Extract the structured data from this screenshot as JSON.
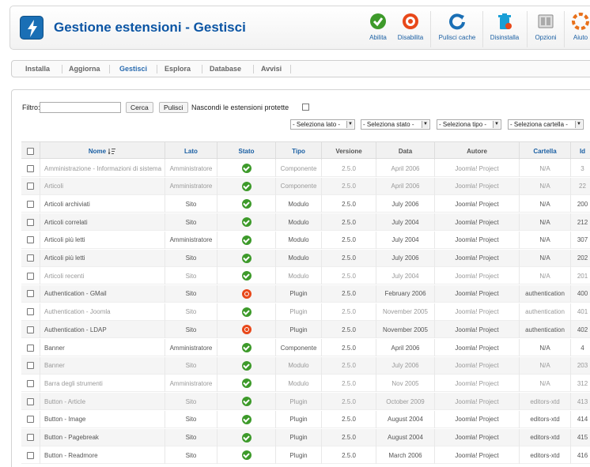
{
  "header": {
    "title": "Gestione estensioni - Gestisci",
    "toolbar": [
      {
        "label": "Abilita",
        "icon": "enable-icon",
        "color": "#3d9a2a"
      },
      {
        "label": "Disabilita",
        "icon": "disable-icon",
        "color": "#e8481a"
      },
      {
        "label": "Pulisci cache",
        "icon": "refresh-icon",
        "color": "#1a6fb5"
      },
      {
        "label": "Disinstalla",
        "icon": "trash-icon",
        "color": "#1a9fd6"
      },
      {
        "label": "Opzioni",
        "icon": "options-icon",
        "color": "#888888"
      },
      {
        "label": "Aiuto",
        "icon": "help-icon",
        "color": "#e8701a"
      }
    ]
  },
  "submenu": {
    "tabs": [
      "Installa",
      "Aggiorna",
      "Gestisci",
      "Esplora",
      "Database",
      "Avvisi"
    ],
    "active": "Gestisci"
  },
  "filter": {
    "label": "Filtro:",
    "value": "",
    "search_label": "Cerca",
    "clear_label": "Pulisci",
    "hide_protected_label": "Nascondi le estensioni protette",
    "hide_protected_checked": false
  },
  "selects": [
    {
      "value": "- Seleziona lato -"
    },
    {
      "value": "- Seleziona stato -"
    },
    {
      "value": "- Seleziona tipo -"
    },
    {
      "value": "- Seleziona cartella -"
    }
  ],
  "table": {
    "columns": [
      "Nome",
      "Lato",
      "Stato",
      "Tipo",
      "Versione",
      "Data",
      "Autore",
      "Cartella",
      "Id"
    ],
    "sorted_by": "Nome",
    "rows": [
      {
        "name": "Amministrazione - Informazioni di sistema",
        "side": "Amministratore",
        "status": "enabled",
        "type": "Componente",
        "version": "2.5.0",
        "date": "April 2006",
        "author": "Joomla! Project",
        "folder": "N/A",
        "id": "3",
        "dim": true
      },
      {
        "name": "Articoli",
        "side": "Amministratore",
        "status": "enabled",
        "type": "Componente",
        "version": "2.5.0",
        "date": "April 2006",
        "author": "Joomla! Project",
        "folder": "N/A",
        "id": "22",
        "dim": true
      },
      {
        "name": "Articoli archiviati",
        "side": "Sito",
        "status": "enabled",
        "type": "Modulo",
        "version": "2.5.0",
        "date": "July 2006",
        "author": "Joomla! Project",
        "folder": "N/A",
        "id": "200",
        "dim": false
      },
      {
        "name": "Articoli correlati",
        "side": "Sito",
        "status": "enabled",
        "type": "Modulo",
        "version": "2.5.0",
        "date": "July 2004",
        "author": "Joomla! Project",
        "folder": "N/A",
        "id": "212",
        "dim": false
      },
      {
        "name": "Articoli più letti",
        "side": "Amministratore",
        "status": "enabled",
        "type": "Modulo",
        "version": "2.5.0",
        "date": "July 2004",
        "author": "Joomla! Project",
        "folder": "N/A",
        "id": "307",
        "dim": false
      },
      {
        "name": "Articoli più letti",
        "side": "Sito",
        "status": "enabled",
        "type": "Modulo",
        "version": "2.5.0",
        "date": "July 2006",
        "author": "Joomla! Project",
        "folder": "N/A",
        "id": "202",
        "dim": false
      },
      {
        "name": "Articoli recenti",
        "side": "Sito",
        "status": "enabled",
        "type": "Modulo",
        "version": "2.5.0",
        "date": "July 2004",
        "author": "Joomla! Project",
        "folder": "N/A",
        "id": "201",
        "dim": true
      },
      {
        "name": "Authentication - GMail",
        "side": "Sito",
        "status": "disabled",
        "type": "Plugin",
        "version": "2.5.0",
        "date": "February 2006",
        "author": "Joomla! Project",
        "folder": "authentication",
        "id": "400",
        "dim": false
      },
      {
        "name": "Authentication - Joomla",
        "side": "Sito",
        "status": "enabled",
        "type": "Plugin",
        "version": "2.5.0",
        "date": "November 2005",
        "author": "Joomla! Project",
        "folder": "authentication",
        "id": "401",
        "dim": true
      },
      {
        "name": "Authentication - LDAP",
        "side": "Sito",
        "status": "disabled",
        "type": "Plugin",
        "version": "2.5.0",
        "date": "November 2005",
        "author": "Joomla! Project",
        "folder": "authentication",
        "id": "402",
        "dim": false
      },
      {
        "name": "Banner",
        "side": "Amministratore",
        "status": "enabled",
        "type": "Componente",
        "version": "2.5.0",
        "date": "April 2006",
        "author": "Joomla! Project",
        "folder": "N/A",
        "id": "4",
        "dim": false
      },
      {
        "name": "Banner",
        "side": "Sito",
        "status": "enabled",
        "type": "Modulo",
        "version": "2.5.0",
        "date": "July 2006",
        "author": "Joomla! Project",
        "folder": "N/A",
        "id": "203",
        "dim": true
      },
      {
        "name": "Barra degli strumenti",
        "side": "Amministratore",
        "status": "enabled",
        "type": "Modulo",
        "version": "2.5.0",
        "date": "Nov 2005",
        "author": "Joomla! Project",
        "folder": "N/A",
        "id": "312",
        "dim": true
      },
      {
        "name": "Button - Article",
        "side": "Sito",
        "status": "enabled",
        "type": "Plugin",
        "version": "2.5.0",
        "date": "October 2009",
        "author": "Joomla! Project",
        "folder": "editors-xtd",
        "id": "413",
        "dim": true
      },
      {
        "name": "Button - Image",
        "side": "Sito",
        "status": "enabled",
        "type": "Plugin",
        "version": "2.5.0",
        "date": "August 2004",
        "author": "Joomla! Project",
        "folder": "editors-xtd",
        "id": "414",
        "dim": false
      },
      {
        "name": "Button - Pagebreak",
        "side": "Sito",
        "status": "enabled",
        "type": "Plugin",
        "version": "2.5.0",
        "date": "August 2004",
        "author": "Joomla! Project",
        "folder": "editors-xtd",
        "id": "415",
        "dim": false
      },
      {
        "name": "Button - Readmore",
        "side": "Sito",
        "status": "enabled",
        "type": "Plugin",
        "version": "2.5.0",
        "date": "March 2006",
        "author": "Joomla! Project",
        "folder": "editors-xtd",
        "id": "416",
        "dim": false
      }
    ]
  }
}
